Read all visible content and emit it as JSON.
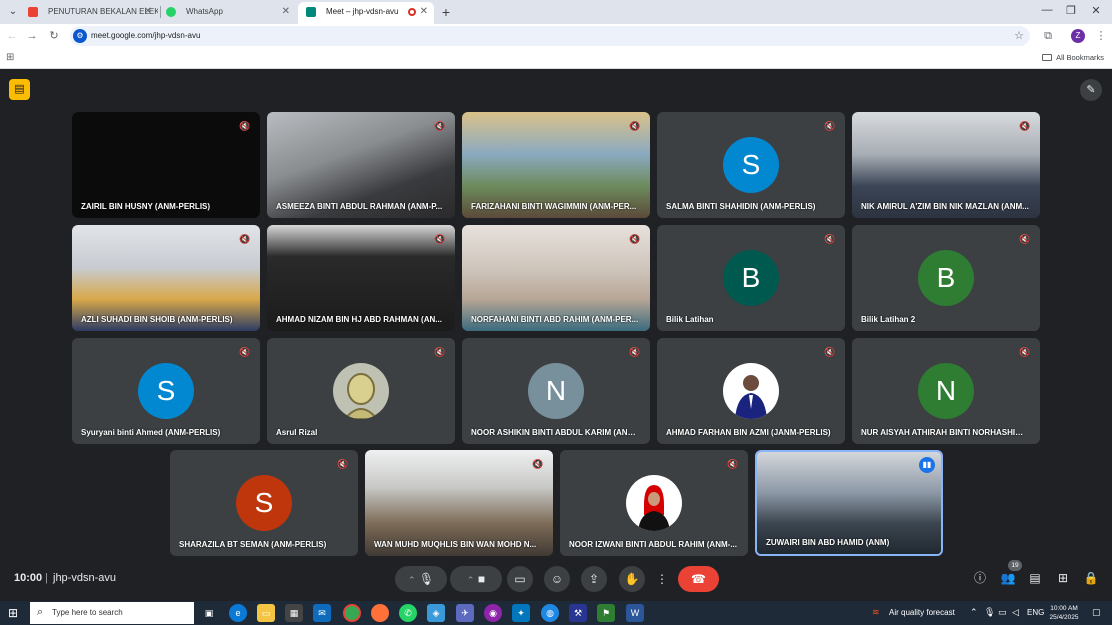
{
  "browser": {
    "tabs": [
      {
        "label": "PENUTURAN BEKALAN ELEKTRIK",
        "favicon_color": "#ea4335"
      },
      {
        "label": "WhatsApp",
        "favicon_color": "#25d366"
      },
      {
        "label": "Meet – jhp-vdsn-avu",
        "favicon_color": "#00897b"
      }
    ],
    "url": "meet.google.com/jhp-vdsn-avu",
    "profile_initial": "Z",
    "bookmarks_label": "All Bookmarks"
  },
  "participants": [
    {
      "name": "ZAIRIL BIN HUSNY (ANM-PERLIS)",
      "type": "video-black"
    },
    {
      "name": "ASMEEZA BINTI ABDUL RAHMAN (ANM-P...",
      "type": "video"
    },
    {
      "name": "FARIZAHANI BINTI WAGIMMIN (ANM-PER...",
      "type": "video"
    },
    {
      "name": "SALMA BINTI SHAHIDIN (ANM-PERLIS)",
      "type": "avatar",
      "initial": "S",
      "color": "#0288d1"
    },
    {
      "name": "NIK AMIRUL A'ZIM BIN NIK MAZLAN (ANM...",
      "type": "video"
    },
    {
      "name": "AZLI SUHADI BIN SHOIB (ANM-PERLIS)",
      "type": "video"
    },
    {
      "name": "AHMAD NIZAM BIN HJ ABD RAHMAN (AN...",
      "type": "video"
    },
    {
      "name": "NORFAHANI BINTI ABD RAHIM (ANM-PER...",
      "type": "video"
    },
    {
      "name": "Bilik Latihan",
      "type": "avatar",
      "initial": "B",
      "color": "#00594f"
    },
    {
      "name": "Bilik Latihan 2",
      "type": "avatar",
      "initial": "B",
      "color": "#2e7d32"
    },
    {
      "name": "Syuryani binti Ahmed (ANM-PERLIS)",
      "type": "avatar",
      "initial": "S",
      "color": "#0288d1"
    },
    {
      "name": "Asrul Rizal",
      "type": "avatar-img"
    },
    {
      "name": "NOOR ASHIKIN BINTI ABDUL KARIM (ANM...",
      "type": "avatar",
      "initial": "N",
      "color": "#78909c"
    },
    {
      "name": "AHMAD FARHAN BIN AZMI (JANM-PERLIS)",
      "type": "avatar-img"
    },
    {
      "name": "NUR AISYAH ATHIRAH BINTI NORHASHIMI ...",
      "type": "avatar",
      "initial": "N",
      "color": "#2e7d32"
    },
    {
      "name": "SHARAZILA BT SEMAN (ANM-PERLIS)",
      "type": "avatar",
      "initial": "S",
      "color": "#bf360c"
    },
    {
      "name": "WAN MUHD MUQHLIS BIN WAN MOHD N...",
      "type": "video"
    },
    {
      "name": "NOOR IZWANI BINTI ABDUL RAHIM (ANM-...",
      "type": "avatar-img"
    },
    {
      "name": "ZUWAIRI BIN ABD HAMID (ANM)",
      "type": "video",
      "speaking": true
    }
  ],
  "meeting": {
    "time": "10:00",
    "separator": "|",
    "code": "jhp-vdsn-avu",
    "people_count": "19"
  },
  "taskbar": {
    "search_placeholder": "Type here to search",
    "weather": "Air quality forecast",
    "lang": "ENG",
    "time": "10:00 AM",
    "date": "25/4/2025"
  }
}
